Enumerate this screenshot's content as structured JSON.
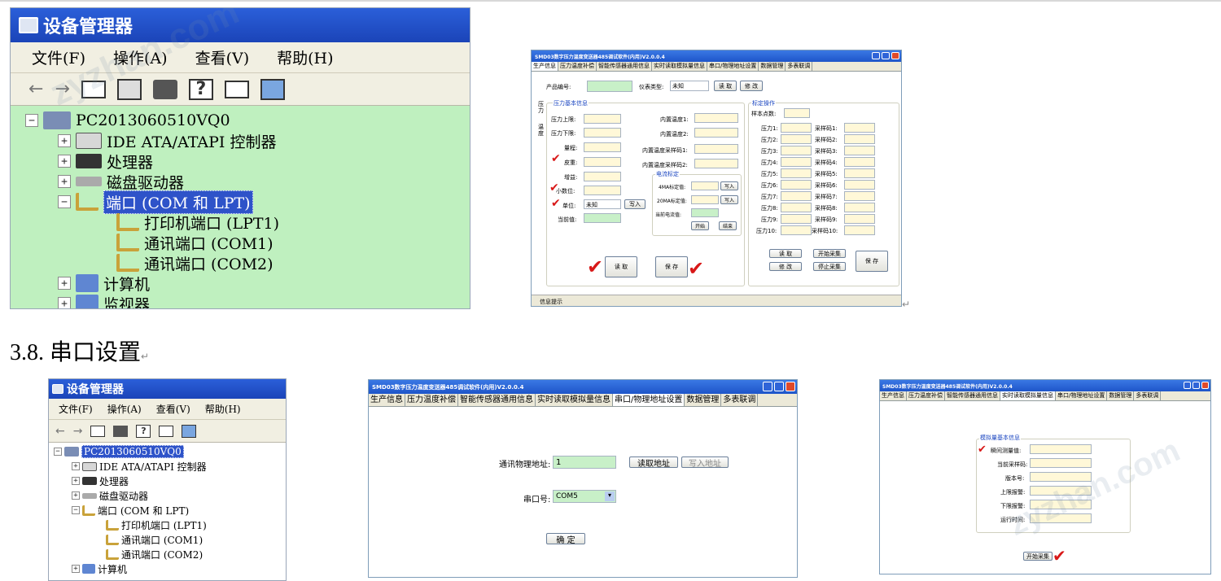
{
  "heading": {
    "text": "3.8. 串口设置",
    "mark": "↵"
  },
  "return_marks": [
    "↵"
  ],
  "watermark": "zyzhan.com",
  "devmgr": {
    "title": "设备管理器",
    "menu": [
      "文件(F)",
      "操作(A)",
      "查看(V)",
      "帮助(H)"
    ],
    "tree": {
      "computer": "PC2013060510VQ0",
      "items": [
        "IDE ATA/ATAPI 控制器",
        "处理器",
        "磁盘驱动器",
        "端口 (COM 和 LPT)",
        "打印机端口 (LPT1)",
        "通讯端口 (COM1)",
        "通讯端口 (COM2)",
        "计算机",
        "监视器"
      ],
      "small_last": "计算机"
    }
  },
  "app": {
    "title": "SMD03数字压力温度变送器485调试软件(内用)V2.0.0.4",
    "tabs": [
      "生产信息",
      "压力温度补偿",
      "智能传感器通用信息",
      "实时读取模拟量信息",
      "串口/物理地址设置",
      "数据管理",
      "多表联调"
    ],
    "tabs_small": [
      "生产信息",
      "压力温度补偿",
      "智能传感器通用信息",
      "实时读取模拟量信息",
      "串口/物理地址设置",
      "数据管理",
      "多表联调"
    ],
    "window1": {
      "product_no": "产品编号:",
      "meter_type": "仪表类型:",
      "meter_value": "未知",
      "read": "读 取",
      "modify": "修 改",
      "side_tabs": [
        "压力",
        "温度"
      ],
      "pressure_group": "压力基本信息",
      "pressure_labels": [
        "压力上限:",
        "压力下限:",
        "量程:",
        "皮重:",
        "增益:",
        "小数位:",
        "单位:",
        "当前值:"
      ],
      "unit_value": "未知",
      "write": "写入",
      "temp_labels": [
        "内置温度1:",
        "内置温度2:",
        "内置温度采样码1:",
        "内置温度采样码2:"
      ],
      "current_group": "电流标定",
      "current_labels": [
        "4MA标定值:",
        "20MA标定值:",
        "当前电流值:"
      ],
      "start": "开始",
      "end": "结束",
      "read_btn": "读 取",
      "save_btn": "保 存",
      "calib_group": "标定操作",
      "sample_points": "样本点数:",
      "pressure_rows": [
        "压力1:",
        "压力2:",
        "压力3:",
        "压力4:",
        "压力5:",
        "压力6:",
        "压力7:",
        "压力8:",
        "压力9:",
        "压力10:"
      ],
      "sample_rows": [
        "采样码1:",
        "采样码2:",
        "采样码3:",
        "采样码4:",
        "采样码5:",
        "采样码6:",
        "采样码7:",
        "采样码8:",
        "采样码9:",
        "采样码10:"
      ],
      "c_read": "读 取",
      "c_modify": "修 改",
      "c_start": "开始采集",
      "c_stop": "停止采集",
      "c_save": "保 存",
      "status": "信息提示"
    },
    "window2": {
      "addr_label": "通讯物理地址:",
      "addr_value": "1",
      "read_addr": "读取地址",
      "write_addr": "写入地址",
      "port_label": "串口号:",
      "port_value": "COM5",
      "ok": "确 定"
    },
    "window3": {
      "group": "模拟量基本信息",
      "labels": [
        "瞬间测量值:",
        "当前采样码:",
        "版本号:",
        "上限报警:",
        "下限报警:",
        "运行时间:"
      ],
      "start": "开始采集"
    }
  },
  "colors": {
    "check": "#d81818",
    "tree_bg": "#bff0bf",
    "title_blue": "#1e55c9"
  }
}
